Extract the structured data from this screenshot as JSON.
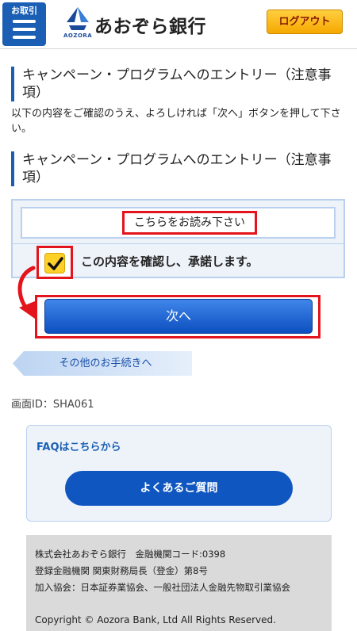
{
  "header": {
    "menu_label": "お取引",
    "brand_name": "あおぞら銀行",
    "brand_sub": "AOZORA",
    "logout_label": "ログアウト"
  },
  "main": {
    "heading1": "キャンペーン・プログラムへのエントリー（注意事項）",
    "intro": "以下の内容をご確認のうえ、よろしければ「次へ」ボタンを押して下さい。",
    "heading2": "キャンペーン・プログラムへのエントリー（注意事項）",
    "read_link": "こちらをお読み下さい",
    "agree_label": "この内容を確認し、承諾します。",
    "agree_checked": true,
    "next_label": "次へ",
    "other_procedures_label": "その他のお手続きへ",
    "screen_id": "画面ID：SHA061"
  },
  "faq": {
    "title": "FAQはこちらから",
    "button_label": "よくあるご質問"
  },
  "footer": {
    "line1": "株式会社あおぞら銀行　金融機関コード:0398",
    "line2": "登録金融機関 関東財務局長（登金）第8号",
    "line3": "加入協会：日本証券業協会、一般社団法人金融先物取引業協会",
    "copyright": "Copyright © Aozora Bank, Ltd All Rights Reserved."
  },
  "colors": {
    "brand_blue": "#1a5fb4",
    "logout_yellow": "#f5a800",
    "highlight_red": "#e3141b",
    "checkbox_yellow": "#ffcf2a"
  },
  "icons": [
    "hamburger-menu-icon",
    "aozora-logo-icon",
    "checkmark-icon",
    "curved-arrow-icon"
  ]
}
